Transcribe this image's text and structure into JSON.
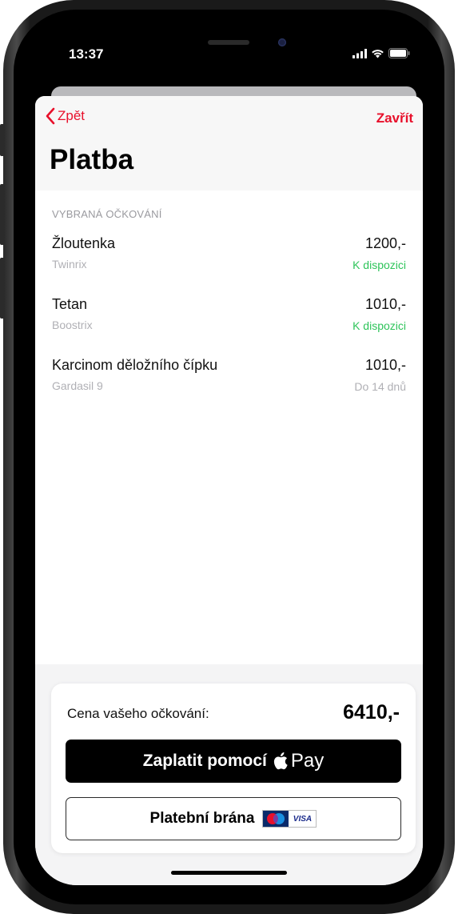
{
  "status_bar": {
    "time": "13:37"
  },
  "nav": {
    "back_label": "Zpět",
    "close_label": "Zavřít",
    "title": "Platba"
  },
  "section": {
    "label": "VYBRANÁ OČKOVÁNÍ"
  },
  "items": [
    {
      "name": "Žloutenka",
      "brand": "Twinrix",
      "price": "1200,-",
      "status": "K dispozici",
      "status_color": "#2ec45a"
    },
    {
      "name": "Tetan",
      "brand": "Boostrix",
      "price": "1010,-",
      "status": "K dispozici",
      "status_color": "#2ec45a"
    },
    {
      "name": "Karcinom děložního čípku",
      "brand": "Gardasil 9",
      "price": "1010,-",
      "status": "Do 14 dnů",
      "status_color": "#b0b0b5"
    }
  ],
  "summary": {
    "price_label": "Cena vašeho očkování:",
    "total": "6410,-"
  },
  "buttons": {
    "apple_pay_label": "Zaplatit pomocí",
    "apple_pay_word": "Pay",
    "gateway_label": "Platební brána",
    "visa_text": "VISA"
  },
  "colors": {
    "accent": "#e8102b",
    "available": "#2ec45a",
    "muted": "#b0b0b5"
  },
  "icons": {
    "back": "chevron-left-icon",
    "signal": "cellular-signal-icon",
    "wifi": "wifi-icon",
    "battery": "battery-icon",
    "apple": "apple-logo-icon",
    "cards": "card-logos-icon"
  }
}
